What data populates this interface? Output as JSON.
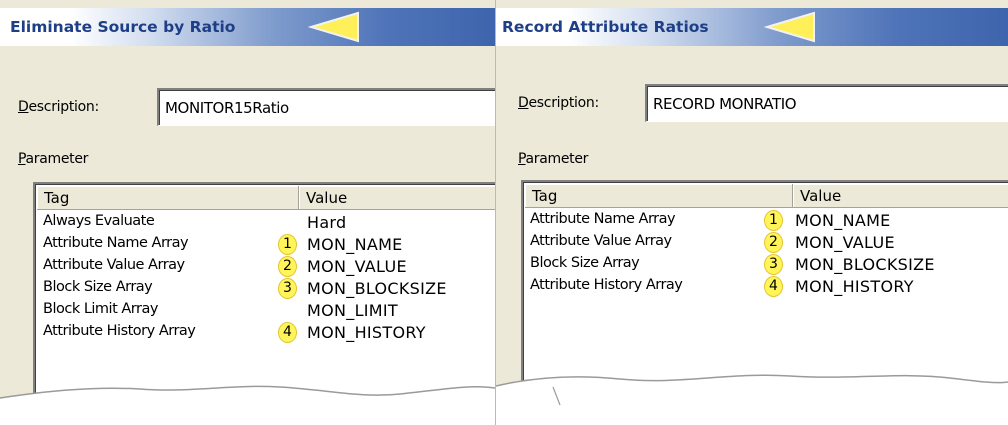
{
  "colors": {
    "badge_fill": "#fff55a",
    "title_text": "#1e3f86",
    "title_bar_end": "#3e64ad",
    "arrow_fill": "#fff05a"
  },
  "left_panel": {
    "title": "Eliminate Source by Ratio",
    "arrow_icon": "yellow-left-arrow",
    "description_label_accel": "D",
    "description_label_rest": "escription:",
    "description_value": "MONITOR15Ratio",
    "parameter_label_accel": "P",
    "parameter_label_rest": "arameter",
    "columns": {
      "tag": "Tag",
      "value": "Value"
    },
    "rows": [
      {
        "tag": "Always Evaluate",
        "badge": "",
        "value": "Hard"
      },
      {
        "tag": "Attribute Name Array",
        "badge": "1",
        "value": "MON_NAME"
      },
      {
        "tag": "Attribute Value Array",
        "badge": "2",
        "value": "MON_VALUE"
      },
      {
        "tag": "Block Size Array",
        "badge": "3",
        "value": "MON_BLOCKSIZE"
      },
      {
        "tag": "Block Limit Array",
        "badge": "",
        "value": "MON_LIMIT"
      },
      {
        "tag": "Attribute History Array",
        "badge": "4",
        "value": "MON_HISTORY"
      }
    ]
  },
  "right_panel": {
    "title": "Record Attribute Ratios",
    "arrow_icon": "yellow-left-arrow",
    "description_label_accel": "D",
    "description_label_rest": "escription:",
    "description_value": "RECORD MONRATIO",
    "parameter_label_accel": "P",
    "parameter_label_rest": "arameter",
    "columns": {
      "tag": "Tag",
      "value": "Value"
    },
    "rows": [
      {
        "tag": "Attribute Name Array",
        "badge": "1",
        "value": "MON_NAME"
      },
      {
        "tag": "Attribute Value Array",
        "badge": "2",
        "value": "MON_VALUE"
      },
      {
        "tag": "Block Size Array",
        "badge": "3",
        "value": "MON_BLOCKSIZE"
      },
      {
        "tag": "Attribute History Array",
        "badge": "4",
        "value": "MON_HISTORY"
      }
    ]
  }
}
